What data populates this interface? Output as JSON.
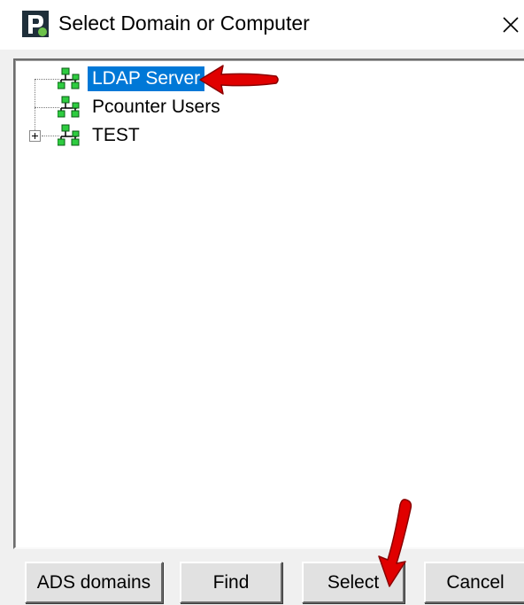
{
  "window": {
    "title": "Select Domain or Computer",
    "close_symbol": "×"
  },
  "tree": {
    "items": [
      {
        "label": "LDAP Server",
        "icon": "network-icon",
        "selected": true,
        "expandable": false
      },
      {
        "label": "Pcounter Users",
        "icon": "network-icon",
        "selected": false,
        "expandable": false
      },
      {
        "label": "TEST",
        "icon": "network-icon",
        "selected": false,
        "expandable": true,
        "expanded": false
      }
    ]
  },
  "buttons": {
    "ads_domains": "ADS domains",
    "find": "Find",
    "select": "Select",
    "cancel": "Cancel"
  },
  "colors": {
    "selection": "#0078d7",
    "annotation_arrow": "#e00000",
    "node_icon_green": "#2ecc40"
  }
}
